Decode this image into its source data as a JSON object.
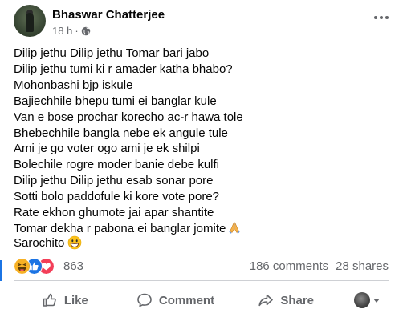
{
  "post": {
    "author": "Bhaswar Chatterjee",
    "time": "18 h",
    "separator": "·",
    "lines": [
      "Dilip jethu Dilip jethu Tomar bari jabo",
      "Dilip jethu tumi ki r amader katha bhabo?",
      "Mohonbashi bjp iskule",
      "Bajiechhile bhepu tumi ei banglar kule",
      "Van e bose prochar korecho ac-r hawa tole",
      "Bhebechhile bangla nebe ek angule tule",
      "Ami je go voter ogo ami je ek shilpi",
      "Bolechile rogre moder banie debe kulfi",
      "Dilip jethu Dilip jethu esab sonar pore",
      "Sotti bolo paddofule ki kore vote pore?",
      "Rate ekhon ghumote jai apar shantite",
      "Tomar dekha r pabona ei banglar jomite"
    ],
    "signoff": "Sarochito"
  },
  "engagement": {
    "reaction_count": "863",
    "comments": "186 comments",
    "shares": "28 shares"
  },
  "actions": {
    "like": "Like",
    "comment": "Comment",
    "share": "Share"
  },
  "icons": {
    "globe": "globe-icon",
    "more": "more-options-icon",
    "pray": "folded-hands-emoji",
    "grin": "grinning-emoji",
    "haha": "haha-reaction-icon",
    "like": "like-reaction-icon",
    "love": "love-reaction-icon"
  },
  "colors": {
    "like_blue": "#1b74e4",
    "love_red": "#f33e58",
    "haha_yellow": "#f7b125",
    "secondary_text": "#65676b"
  }
}
